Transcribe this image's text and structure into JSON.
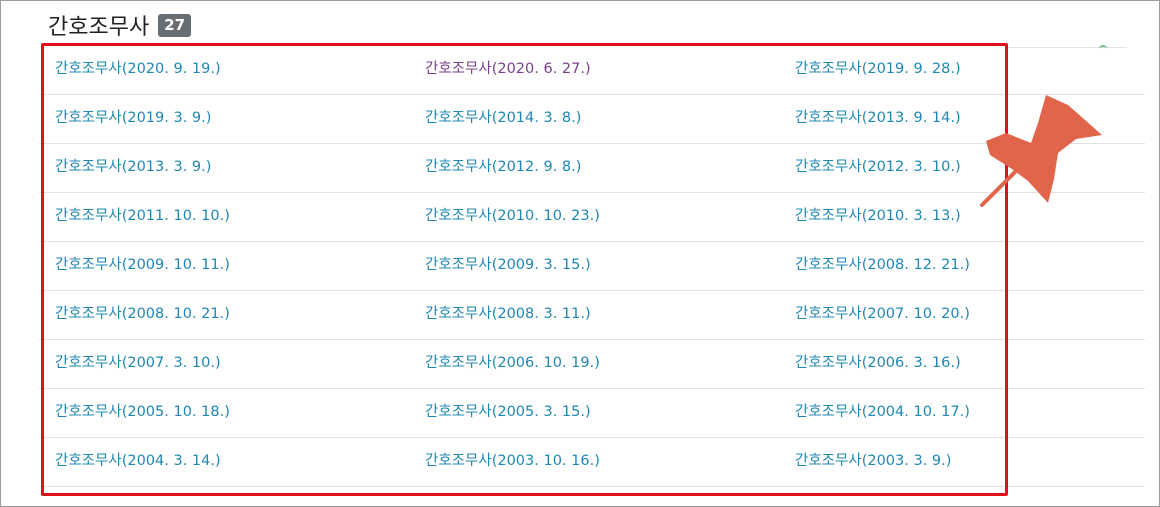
{
  "section": {
    "title": "간호조무사",
    "count": "27"
  },
  "items": [
    [
      "간호조무사(2020. 9. 19.)",
      "간호조무사(2020. 6. 27.)",
      "간호조무사(2019. 9. 28.)"
    ],
    [
      "간호조무사(2019. 3. 9.)",
      "간호조무사(2014. 3. 8.)",
      "간호조무사(2013. 9. 14.)"
    ],
    [
      "간호조무사(2013. 3. 9.)",
      "간호조무사(2012. 9. 8.)",
      "간호조무사(2012. 3. 10.)"
    ],
    [
      "간호조무사(2011. 10. 10.)",
      "간호조무사(2010. 10. 23.)",
      "간호조무사(2010. 3. 13.)"
    ],
    [
      "간호조무사(2009. 10. 11.)",
      "간호조무사(2009. 3. 15.)",
      "간호조무사(2008. 12. 21.)"
    ],
    [
      "간호조무사(2008. 10. 21.)",
      "간호조무사(2008. 3. 11.)",
      "간호조무사(2007. 10. 20.)"
    ],
    [
      "간호조무사(2007. 3. 10.)",
      "간호조무사(2006. 10. 19.)",
      "간호조무사(2006. 3. 16.)"
    ],
    [
      "간호조무사(2005. 10. 18.)",
      "간호조무사(2005. 3. 15.)",
      "간호조무사(2004. 10. 17.)"
    ],
    [
      "간호조무사(2004. 3. 14.)",
      "간호조무사(2003. 10. 16.)",
      "간호조무사(2003. 3. 9.)"
    ]
  ],
  "visited_item": "간호조무사(2020. 6. 27.)",
  "colors": {
    "link": "#1f87b3",
    "visited_link": "#7a3f8e",
    "highlight_border": "#e0101a",
    "pin": "#e0654a",
    "badge_bg": "#666e73"
  },
  "icons": {
    "pin": "pushpin-icon"
  }
}
